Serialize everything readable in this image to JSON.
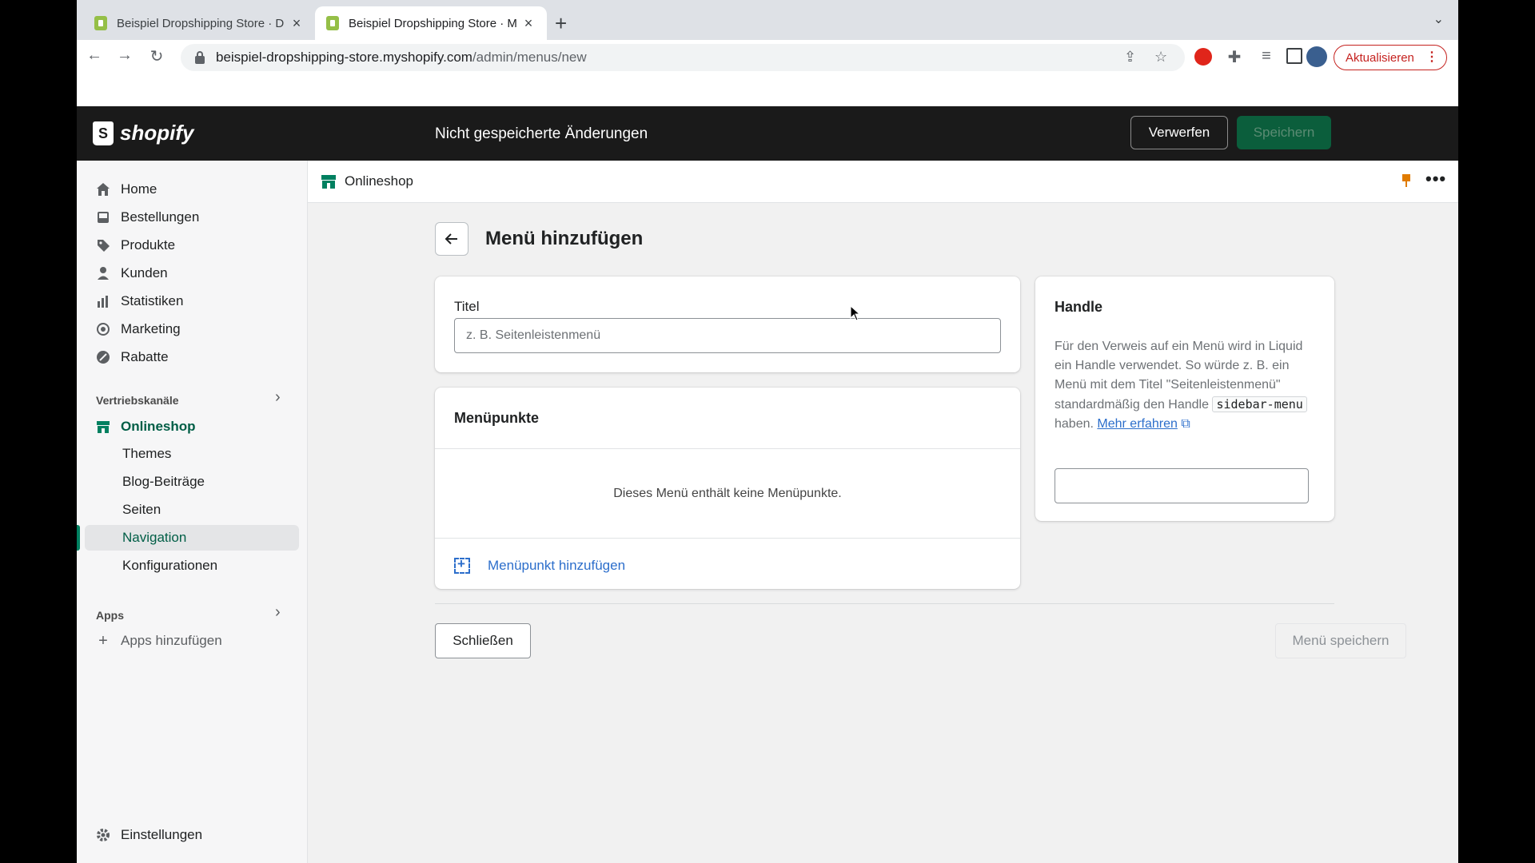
{
  "browser": {
    "tabs": [
      {
        "title": "Beispiel Dropshipping Store · D"
      },
      {
        "title": "Beispiel Dropshipping Store · M"
      }
    ],
    "url_host": "beispiel-dropshipping-store.myshopify.com",
    "url_path": "/admin/menus/new",
    "update_label": "Aktualisieren"
  },
  "topbar": {
    "logo": "shopify",
    "status": "Nicht gespeicherte Änderungen",
    "discard_label": "Verwerfen",
    "save_label": "Speichern"
  },
  "sidebar": {
    "items": [
      {
        "label": "Home",
        "icon": "home-icon"
      },
      {
        "label": "Bestellungen",
        "icon": "orders-icon"
      },
      {
        "label": "Produkte",
        "icon": "tag-icon"
      },
      {
        "label": "Kunden",
        "icon": "person-icon"
      },
      {
        "label": "Statistiken",
        "icon": "bar-chart-icon"
      },
      {
        "label": "Marketing",
        "icon": "target-icon"
      },
      {
        "label": "Rabatte",
        "icon": "discount-icon"
      }
    ],
    "sales_channels_header": "Vertriebskanäle",
    "online_store": "Onlineshop",
    "sub_items": [
      "Themes",
      "Blog-Beiträge",
      "Seiten",
      "Navigation",
      "Konfigurationen"
    ],
    "active_sub_item": "Navigation",
    "apps_header": "Apps",
    "add_apps": "Apps hinzufügen",
    "settings": "Einstellungen"
  },
  "channelbar": {
    "label": "Onlineshop"
  },
  "page": {
    "title": "Menü hinzufügen",
    "title_field_label": "Titel",
    "title_field_placeholder": "z. B. Seitenleistenmenü",
    "title_field_value": "",
    "menu_items_header": "Menüpunkte",
    "empty_message": "Dieses Menü enthält keine Menüpunkte.",
    "add_item_label": "Menüpunkt hinzufügen",
    "close_label": "Schließen",
    "save_menu_label": "Menü speichern"
  },
  "handle_card": {
    "title": "Handle",
    "desc_part1": "Für den Verweis auf ein Menü wird in Liquid ein Handle verwendet. So würde z. B. ein Menü mit dem Titel \"Seitenleistenmenü\" standardmäßig den Handle ",
    "code": "sidebar-menu",
    "desc_part2": " haben. ",
    "link": "Mehr erfahren",
    "handle_value": ""
  },
  "colors": {
    "topbar_bg": "#1a1a1a",
    "primary_green": "#008060",
    "link_blue": "#2c6ecb",
    "update_red": "#c5221f"
  }
}
